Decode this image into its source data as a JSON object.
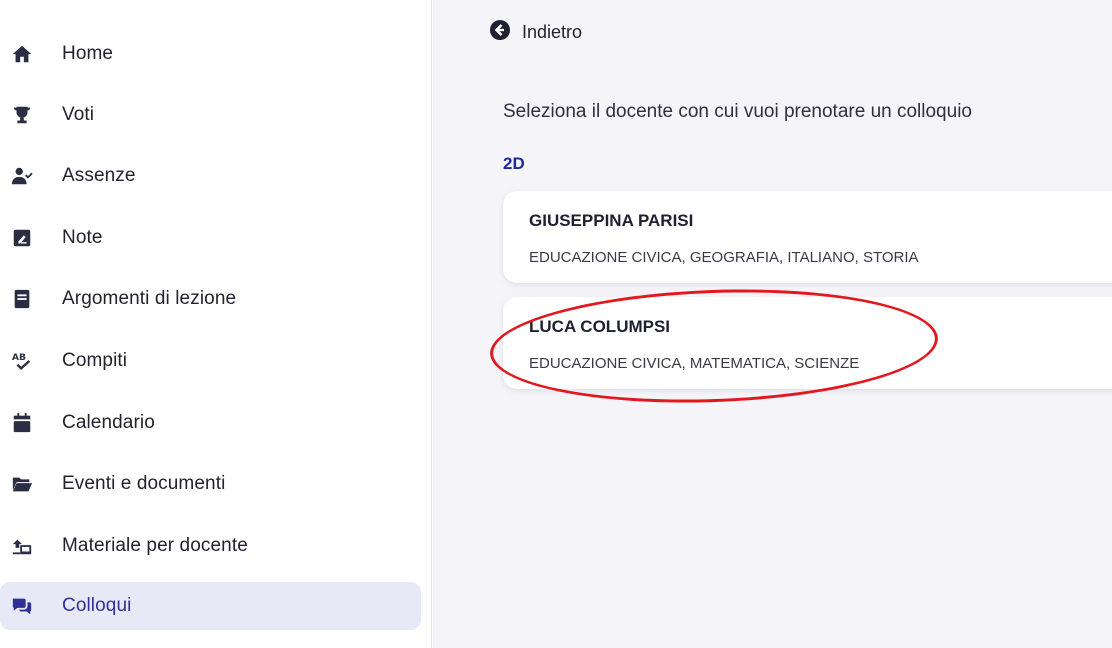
{
  "sidebar": {
    "items": [
      {
        "label": "Home",
        "icon": "home-icon",
        "active": false
      },
      {
        "label": "Voti",
        "icon": "trophy-icon",
        "active": false
      },
      {
        "label": "Assenze",
        "icon": "user-check-icon",
        "active": false
      },
      {
        "label": "Note",
        "icon": "note-pencil-icon",
        "active": false
      },
      {
        "label": "Argomenti di lezione",
        "icon": "book-icon",
        "active": false
      },
      {
        "label": "Compiti",
        "icon": "spellcheck-icon",
        "active": false
      },
      {
        "label": "Calendario",
        "icon": "calendar-icon",
        "active": false
      },
      {
        "label": "Eventi e documenti",
        "icon": "folder-open-icon",
        "active": false
      },
      {
        "label": "Materiale per docente",
        "icon": "share-screen-icon",
        "active": false
      },
      {
        "label": "Colloqui",
        "icon": "chat-bubbles-icon",
        "active": true
      }
    ]
  },
  "main": {
    "back_label": "Indietro",
    "intro": "Seleziona il docente con cui vuoi prenotare un colloquio",
    "class_label": "2D",
    "teachers": [
      {
        "name": "GIUSEPPINA PARISI",
        "subjects": "EDUCAZIONE CIVICA, GEOGRAFIA, ITALIANO, STORIA"
      },
      {
        "name": "LUCA COLUMPSI",
        "subjects": "EDUCAZIONE CIVICA, MATEMATICA, SCIENZE"
      }
    ]
  },
  "colors": {
    "accent": "#2f3197",
    "active_bg": "#e8e9f7",
    "highlight": "#e3181e",
    "class_label": "#1f2aa0"
  }
}
